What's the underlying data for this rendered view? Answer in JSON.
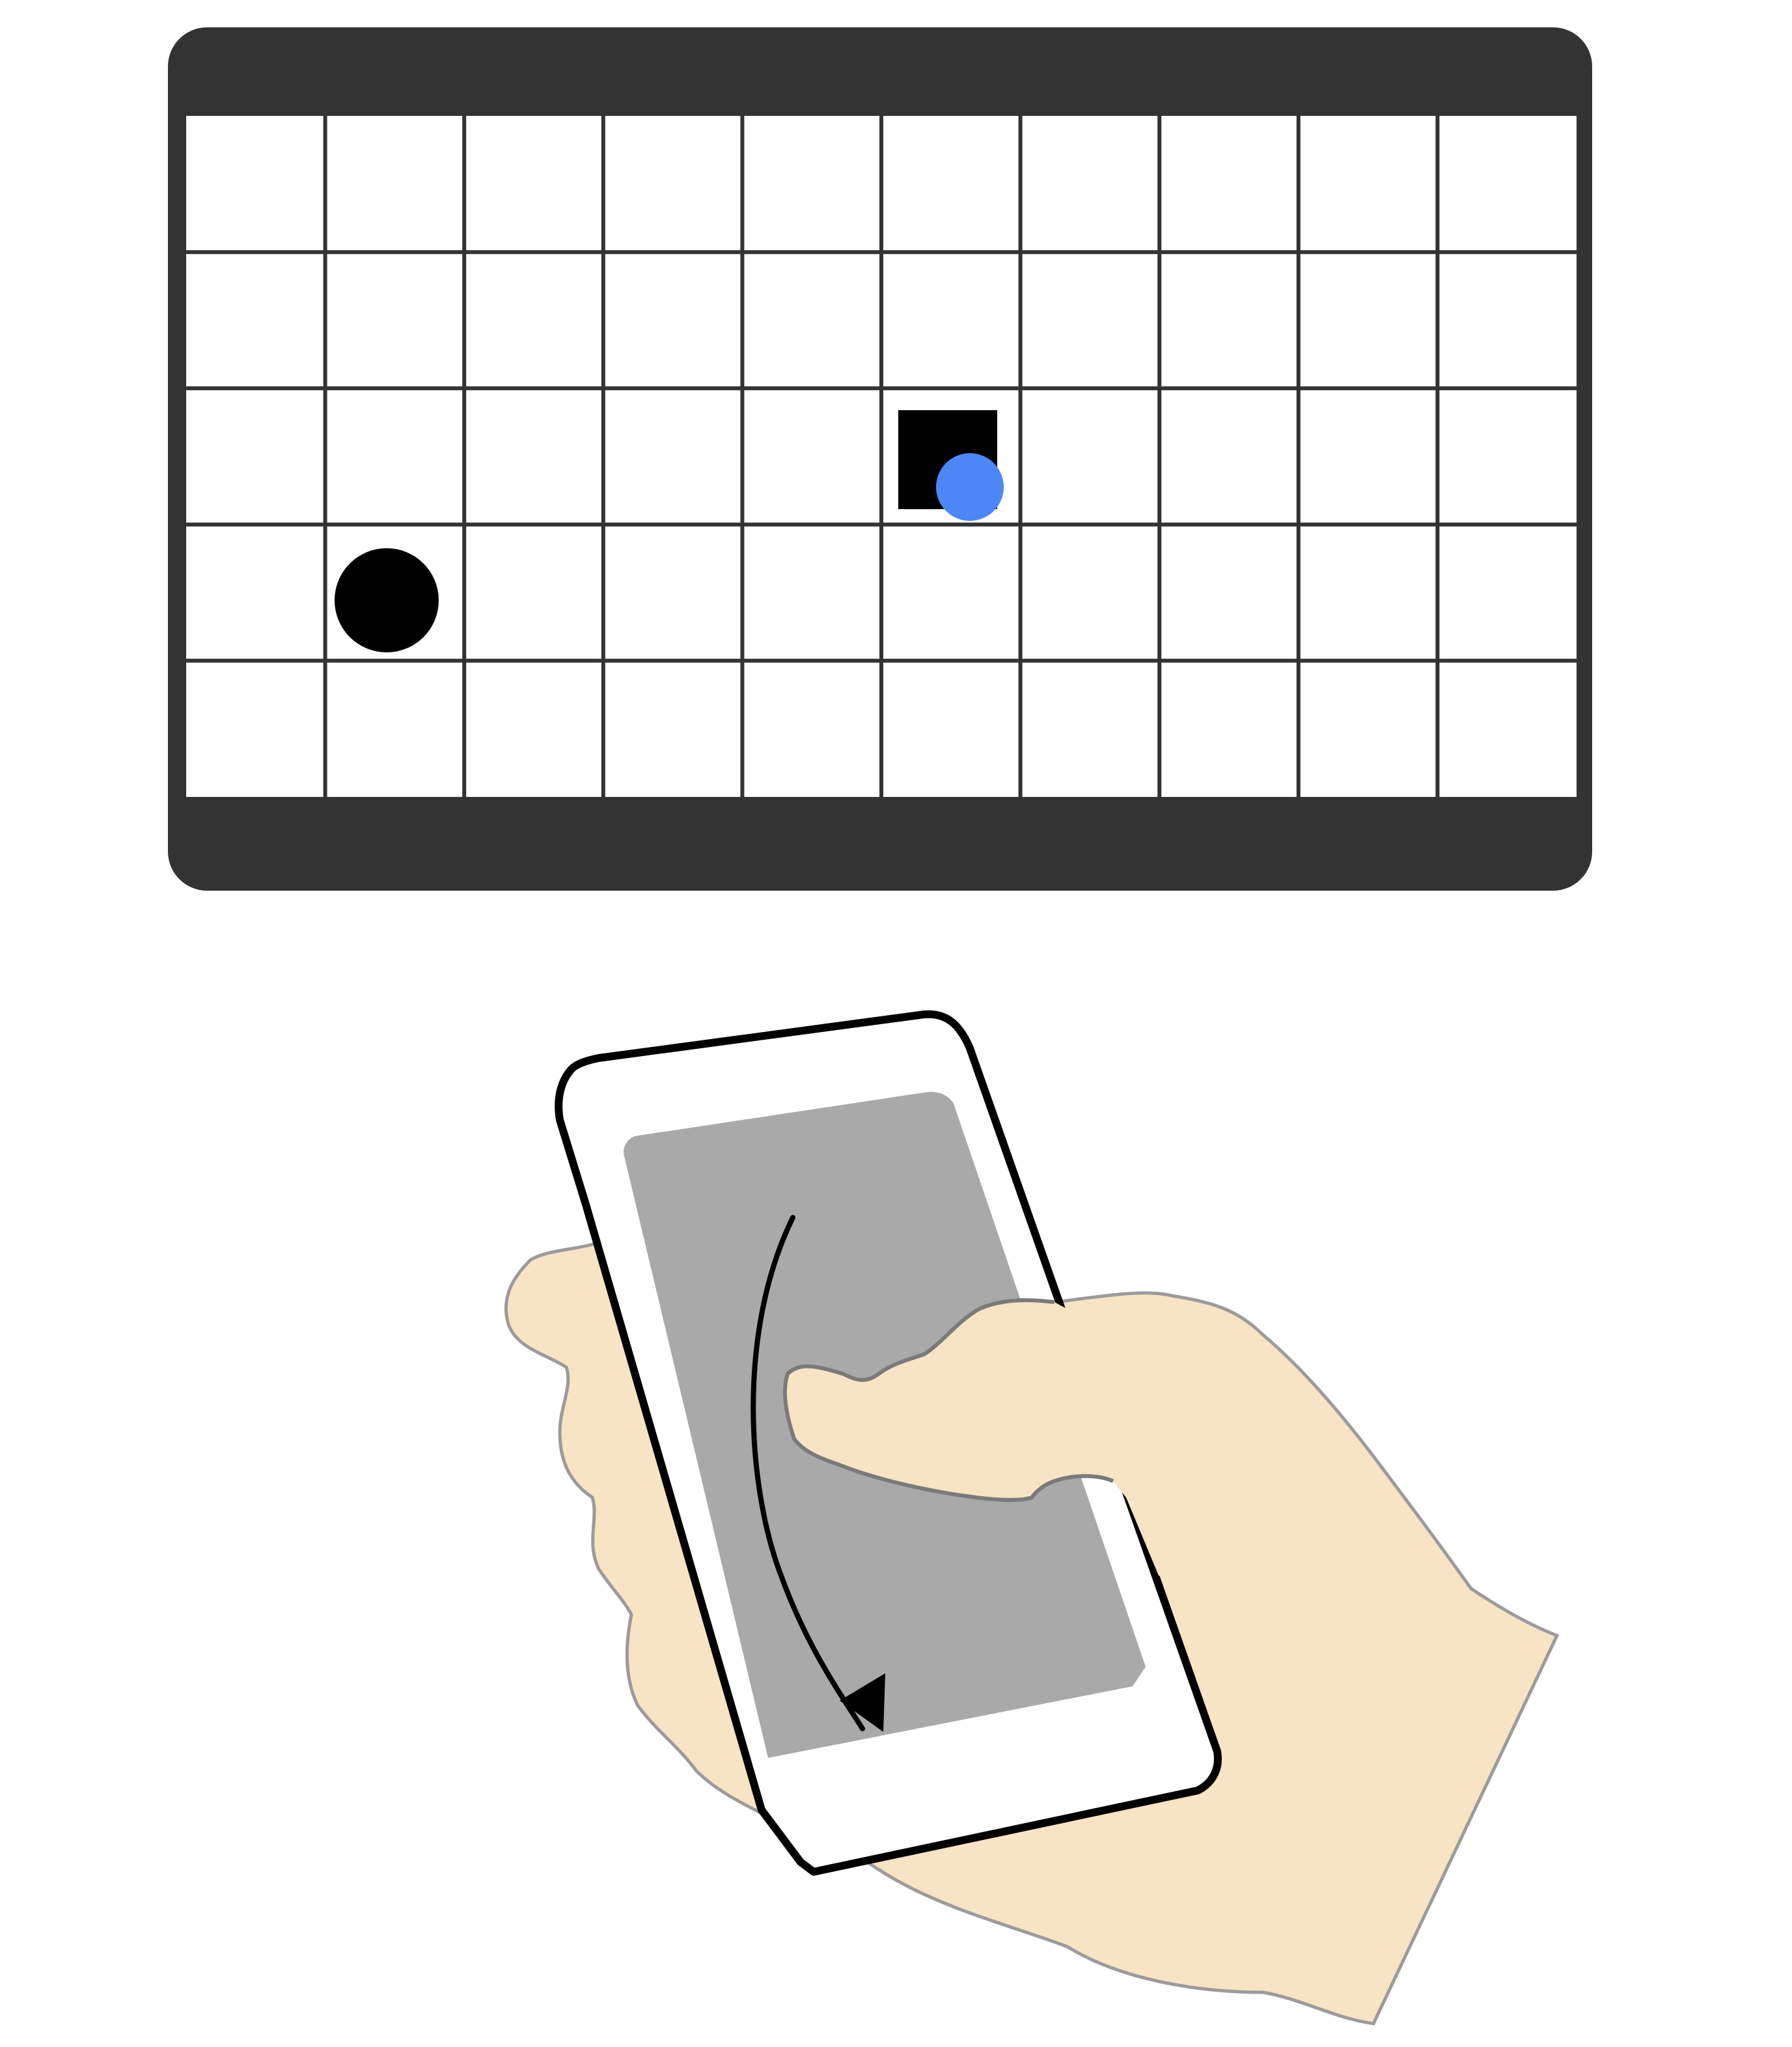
{
  "display": {
    "rows": 5,
    "cols": 10,
    "bezel_color": "#333333",
    "grid_line_color": "#333333",
    "cell_color": "#ffffff",
    "target": {
      "col": 5,
      "row": 2,
      "shape": "square",
      "color": "#000000"
    },
    "player_circle": {
      "col": 1,
      "row": 3,
      "shape": "circle",
      "color": "#000000"
    },
    "cursor_dot": {
      "col": 5,
      "row": 2,
      "shape": "circle",
      "color": "#4d86f7"
    }
  },
  "phone": {
    "body_color": "#ffffff",
    "outline_color": "#000000",
    "screen_color": "#a9a9a9",
    "gesture": {
      "type": "curved-swipe",
      "direction": "down",
      "arrow_color": "#000000"
    }
  },
  "hand": {
    "skin_color": "#f8e3c5",
    "outline_color": "#9b9b9b"
  }
}
